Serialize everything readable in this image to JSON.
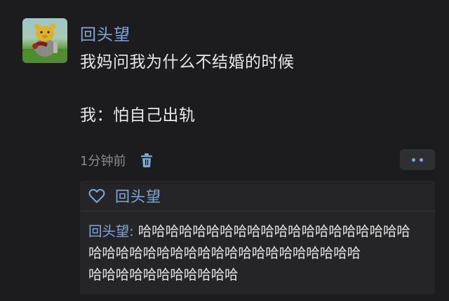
{
  "post": {
    "author": "回头望",
    "content_lines": [
      "我妈问我为什么不结婚的时候",
      "我：怕自己出轨"
    ],
    "timestamp": "1分钟前"
  },
  "icons": {
    "delete": "trash-icon",
    "more": "more-dots-icon",
    "like": "heart-outline-icon"
  },
  "likes": {
    "names": "回头望"
  },
  "comment": {
    "author": "回头望",
    "separator": ": ",
    "lines": [
      "哈哈哈哈哈哈哈哈哈哈哈哈哈哈哈哈哈哈哈哈",
      "哈哈哈哈哈哈哈哈哈哈哈哈哈哈哈哈哈哈哈哈",
      "哈哈哈哈哈哈哈哈哈哈哈"
    ]
  },
  "colors": {
    "background": "#1c1c1e",
    "link_blue": "#7ea8d8",
    "text": "#e8e8e8",
    "muted": "#8a8a8e",
    "panel": "#252528"
  }
}
